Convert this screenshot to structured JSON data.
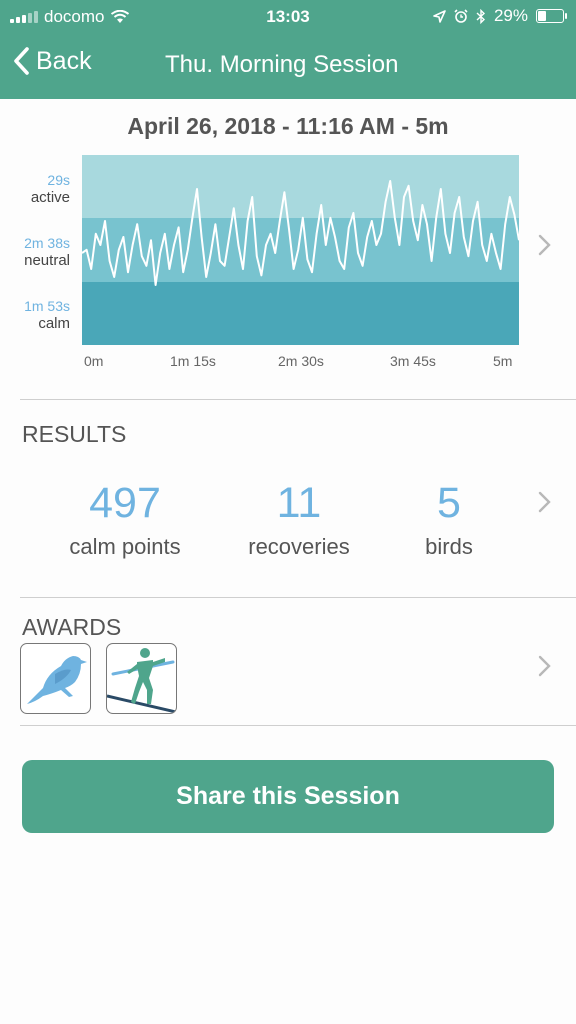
{
  "status_bar": {
    "carrier": "docomo",
    "time": "13:03",
    "battery": "29%"
  },
  "nav": {
    "back_label": "Back",
    "title": "Thu. Morning Session"
  },
  "session": {
    "date": "April 26, 2018 - 11:16 AM - 5m"
  },
  "chart": {
    "y_labels": [
      {
        "time": "29s",
        "name": "active"
      },
      {
        "time": "2m 38s",
        "name": "neutral"
      },
      {
        "time": "1m 53s",
        "name": "calm"
      }
    ],
    "x_ticks": [
      "0m",
      "1m 15s",
      "2m 30s",
      "3m 45s",
      "5m"
    ]
  },
  "chart_data": {
    "type": "line",
    "xlabel": "",
    "ylabel": "",
    "x_ticks": [
      "0m",
      "1m 15s",
      "2m 30s",
      "3m 45s",
      "5m"
    ],
    "bands": [
      "active",
      "neutral",
      "calm"
    ],
    "colors": {
      "active": "#a8d9de",
      "neutral": "#78c3cf",
      "calm": "#4aa7b8",
      "line": "#ffffff"
    },
    "values": [
      0.5,
      0.52,
      0.4,
      0.62,
      0.55,
      0.7,
      0.45,
      0.35,
      0.52,
      0.6,
      0.38,
      0.55,
      0.68,
      0.48,
      0.42,
      0.58,
      0.3,
      0.5,
      0.62,
      0.4,
      0.55,
      0.66,
      0.38,
      0.52,
      0.72,
      0.9,
      0.6,
      0.35,
      0.5,
      0.68,
      0.45,
      0.42,
      0.6,
      0.78,
      0.55,
      0.4,
      0.7,
      0.85,
      0.48,
      0.36,
      0.55,
      0.62,
      0.5,
      0.7,
      0.88,
      0.65,
      0.4,
      0.52,
      0.72,
      0.46,
      0.38,
      0.62,
      0.8,
      0.55,
      0.72,
      0.6,
      0.45,
      0.4,
      0.66,
      0.75,
      0.5,
      0.42,
      0.6,
      0.7,
      0.55,
      0.62,
      0.82,
      0.95,
      0.72,
      0.55,
      0.85,
      0.92,
      0.7,
      0.58,
      0.8,
      0.68,
      0.45,
      0.72,
      0.9,
      0.62,
      0.5,
      0.75,
      0.85,
      0.6,
      0.48,
      0.7,
      0.82,
      0.55,
      0.45,
      0.62,
      0.5,
      0.4,
      0.68,
      0.85,
      0.74,
      0.58
    ]
  },
  "results": {
    "heading": "RESULTS",
    "stats": [
      {
        "value": "497",
        "label": "calm points"
      },
      {
        "value": "11",
        "label": "recoveries"
      },
      {
        "value": "5",
        "label": "birds"
      }
    ]
  },
  "awards": {
    "heading": "AWARDS",
    "items": [
      {
        "icon": "bird-award-icon"
      },
      {
        "icon": "tightrope-walker-award-icon"
      }
    ]
  },
  "share": {
    "label": "Share this Session"
  }
}
